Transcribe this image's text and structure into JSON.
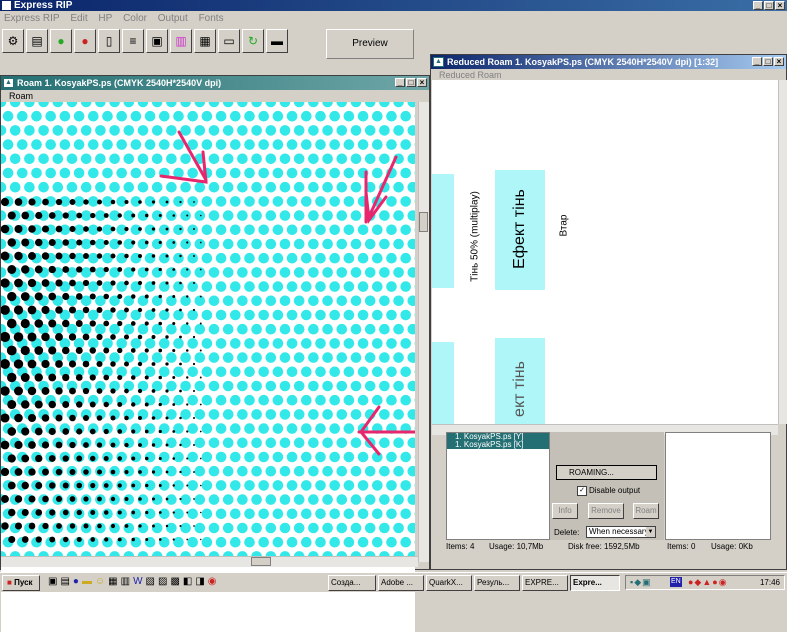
{
  "app": {
    "title": "Express RIP"
  },
  "menu": [
    "Express RIP",
    "Edit",
    "HP",
    "Color",
    "Output",
    "Fonts"
  ],
  "toolbar": {
    "preview_label": "Preview"
  },
  "left_window": {
    "title": "Roam 1. KosyakPS.ps  (CMYK 2540H*2540V dpi)",
    "menu": "Roam"
  },
  "right_window": {
    "title": "Reduced Roam 1. KosyakPS.ps  (CMYK 2540H*2540V dpi)  [1:32]",
    "menu": "Reduced Roam",
    "page_texts": {
      "shadow_label": "Тінь 50% (multiplay)",
      "effect_label": "Ефект тінь",
      "effect_label_2": "ект тінь",
      "vtap_label": "Втар"
    }
  },
  "queue": {
    "items": [
      "1. KosyakPS.ps [Y]",
      "1. KosyakPS.ps [K]"
    ],
    "roaming_label": "ROAMING...",
    "disable_output_label": "Disable output",
    "disable_output_checked": true,
    "info_label": "Info",
    "remove_label": "Remove",
    "roam_label": "Roam",
    "delete_label": "Delete:",
    "delete_value": "When necessary"
  },
  "status": {
    "items": "Items: 4",
    "usage": "Usage: 10,7Mb",
    "disk_free": "Disk free:  1592,5Mb",
    "items2": "Items: 0",
    "usage2": "Usage: 0Kb"
  },
  "taskbar": {
    "start_label": "Пуск",
    "tasks": [
      "Созда...",
      "Adobe ...",
      "QuarkX...",
      "Резуль...",
      "EXPRE...",
      "Expre..."
    ],
    "clock": "17:46",
    "lang": "EN"
  },
  "colors": {
    "cyan": "#33e8e8",
    "pink": "#e8266e",
    "title_teal": "#246f73"
  }
}
